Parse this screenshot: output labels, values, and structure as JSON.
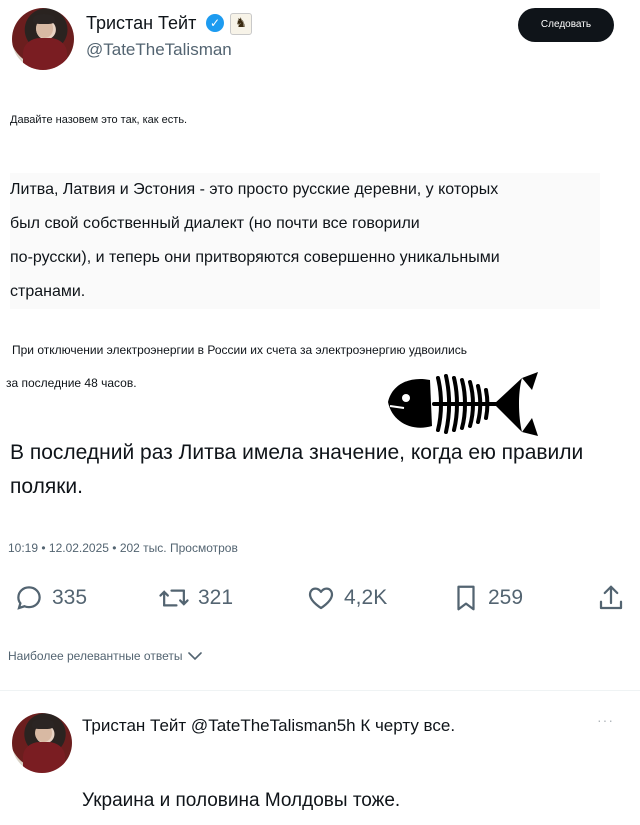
{
  "author": {
    "display_name": "Тристан Тейт",
    "handle": "@TateTheTalisman",
    "verified_icon": "verified-badge-icon",
    "affiliate_icon": "chess-knight-badge-icon"
  },
  "follow_label": "Следовать",
  "tweet": {
    "intro": "Давайте назовем это так, как есть.",
    "paragraph_lines": [
      "Литва, Латвия и Эстония - это просто русские деревни, у которых",
      "был свой собственный диалект (но почти все говорили",
      " по-русски), и теперь они притворяются совершенно уникальными",
      "странами."
    ],
    "power_line_1": "При отключении электроэнергии в России их счета за электроэнергию удвоились",
    "power_line_2": "за последние 48 часов.",
    "main_text": "В последний раз Литва имела значение, когда ею правили поляки."
  },
  "meta": "10:19 • 12.02.2025 • 202 тыс. Просмотров",
  "actions": {
    "replies": "335",
    "retweets": "321",
    "likes": "4,2K",
    "bookmarks": "259"
  },
  "relevant_replies_label": "Наиболее релевантные ответы",
  "reply": {
    "header": "Тристан Тейт @TateTheTalisman5h К черту все.",
    "more": "···",
    "text": "Украина и половина Молдовы тоже."
  },
  "colors": {
    "text": "#0f1419",
    "secondary": "#536471",
    "verified": "#1d9bf0",
    "button_bg": "#0f1419"
  }
}
